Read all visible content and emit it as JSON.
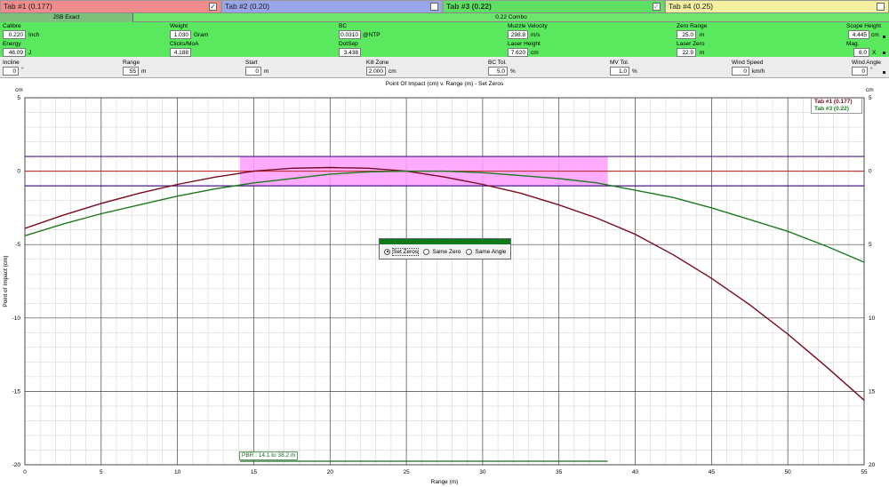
{
  "tabs": [
    {
      "label": "Tab #1 (0.177)",
      "checked": true
    },
    {
      "label": "Tab #2 (0.20)",
      "checked": false
    },
    {
      "label": "Tab #3 (0.22)",
      "checked": true
    },
    {
      "label": "Tab #4 (0.25)",
      "checked": false
    }
  ],
  "ammo": {
    "tab1": "JSB Exact",
    "tab3": "0.22 Combo"
  },
  "params": {
    "calibre": {
      "label": "Calibre",
      "value": "0.220",
      "unit": "Inch"
    },
    "weight": {
      "label": "Weight",
      "value": "1.030",
      "unit": "Gram"
    },
    "bc": {
      "label": "BC",
      "value": "0.0310",
      "unit": "@NTP"
    },
    "muzzle_velocity": {
      "label": "Muzzle Velocity",
      "value": "298.8",
      "unit": "m/s"
    },
    "zero_range": {
      "label": "Zero Range",
      "value": "25.0",
      "unit": "m"
    },
    "scope_height": {
      "label": "Scope Height",
      "value": "4.445",
      "unit": "cm"
    },
    "energy": {
      "label": "Energy",
      "value": "46.09",
      "unit": "J"
    },
    "clicks_moa": {
      "label": "Clicks/MoA",
      "value": "4.188",
      "unit": ""
    },
    "dotsep": {
      "label": "DotSep",
      "value": "3.438",
      "unit": ""
    },
    "laser_height": {
      "label": "Laser Height",
      "value": "7.620",
      "unit": "cm"
    },
    "laser_zero": {
      "label": "Laser Zero",
      "value": "22.9",
      "unit": "m"
    },
    "mag": {
      "label": "Mag.",
      "value": "6.0",
      "unit": "X"
    },
    "incline": {
      "label": "Incline",
      "value": "0",
      "unit": "°"
    },
    "range": {
      "label": "Range",
      "value": "55",
      "unit": "m"
    },
    "start": {
      "label": "Start",
      "value": "0",
      "unit": "m"
    },
    "kill_zone": {
      "label": "Kill Zone",
      "value": "2.000",
      "unit": "cm"
    },
    "bc_tol": {
      "label": "BC Tol.",
      "value": "5.0",
      "unit": "%"
    },
    "mv_tol": {
      "label": "MV Tol.",
      "value": "1.0",
      "unit": "%"
    },
    "wind_speed": {
      "label": "Wind Speed",
      "value": "0",
      "unit": "km/h"
    },
    "wind_angle": {
      "label": "Wind Angle",
      "value": "0",
      "unit": "°"
    }
  },
  "zero_mode": {
    "options": [
      "Set Zeros",
      "Same Zero",
      "Same Angle"
    ],
    "selected": "Set Zeros"
  },
  "colors": {
    "tab1": "#7a0a1e",
    "tab3": "#1c7a1c",
    "kill_band": "#ff9cff",
    "kill_line": "#4a1a8a",
    "zero_line": "#c02020"
  },
  "chart_data": {
    "type": "line",
    "title": "Point Of Impact (cm) v. Range (m) - Set Zeros",
    "xlabel": "Range (m)",
    "ylabel": "Point of Impact (cm)",
    "y_unit": "cm",
    "xlim": [
      0,
      55
    ],
    "ylim": [
      -20,
      5
    ],
    "x_ticks": [
      0,
      5,
      10,
      15,
      20,
      25,
      30,
      35,
      40,
      45,
      50,
      55
    ],
    "y_ticks": [
      5,
      0,
      -5,
      -10,
      -15,
      -20
    ],
    "grid": true,
    "legend_position": "top-right",
    "series": [
      {
        "name": "Tab #1 (0.177)",
        "color": "#7a0a1e",
        "x": [
          0,
          2.5,
          5,
          7.5,
          10,
          12.5,
          15,
          17.5,
          20,
          22.5,
          25,
          27.5,
          30,
          32.5,
          35,
          37.5,
          40,
          42.5,
          45,
          47.5,
          50,
          52.5,
          55
        ],
        "y": [
          -3.9,
          -3.0,
          -2.2,
          -1.5,
          -0.9,
          -0.4,
          0.0,
          0.2,
          0.25,
          0.2,
          0.0,
          -0.4,
          -0.9,
          -1.5,
          -2.3,
          -3.2,
          -4.3,
          -5.7,
          -7.3,
          -9.1,
          -11.1,
          -13.3,
          -15.6
        ]
      },
      {
        "name": "Tab #3 (0.22)",
        "color": "#1c7a1c",
        "x": [
          0,
          2.5,
          5,
          7.5,
          10,
          12.5,
          15,
          17.5,
          20,
          22.5,
          25,
          27.5,
          30,
          32.5,
          35,
          37.5,
          40,
          42.5,
          45,
          47.5,
          50,
          52.5,
          55
        ],
        "y": [
          -4.4,
          -3.6,
          -2.9,
          -2.3,
          -1.7,
          -1.2,
          -0.8,
          -0.5,
          -0.2,
          -0.05,
          0.0,
          0.0,
          -0.1,
          -0.3,
          -0.5,
          -0.8,
          -1.3,
          -1.8,
          -2.5,
          -3.3,
          -4.1,
          -5.1,
          -6.2
        ]
      }
    ],
    "kill_zone_band": {
      "x_from": 14.1,
      "x_to": 38.2,
      "y_from": -1.0,
      "y_to": 1.0
    },
    "kill_zone_lines": [
      1.0,
      -1.0
    ],
    "pbr_label": "PBR : 14.1 to 38.2 m",
    "pbr_range": [
      14.1,
      38.2
    ]
  }
}
